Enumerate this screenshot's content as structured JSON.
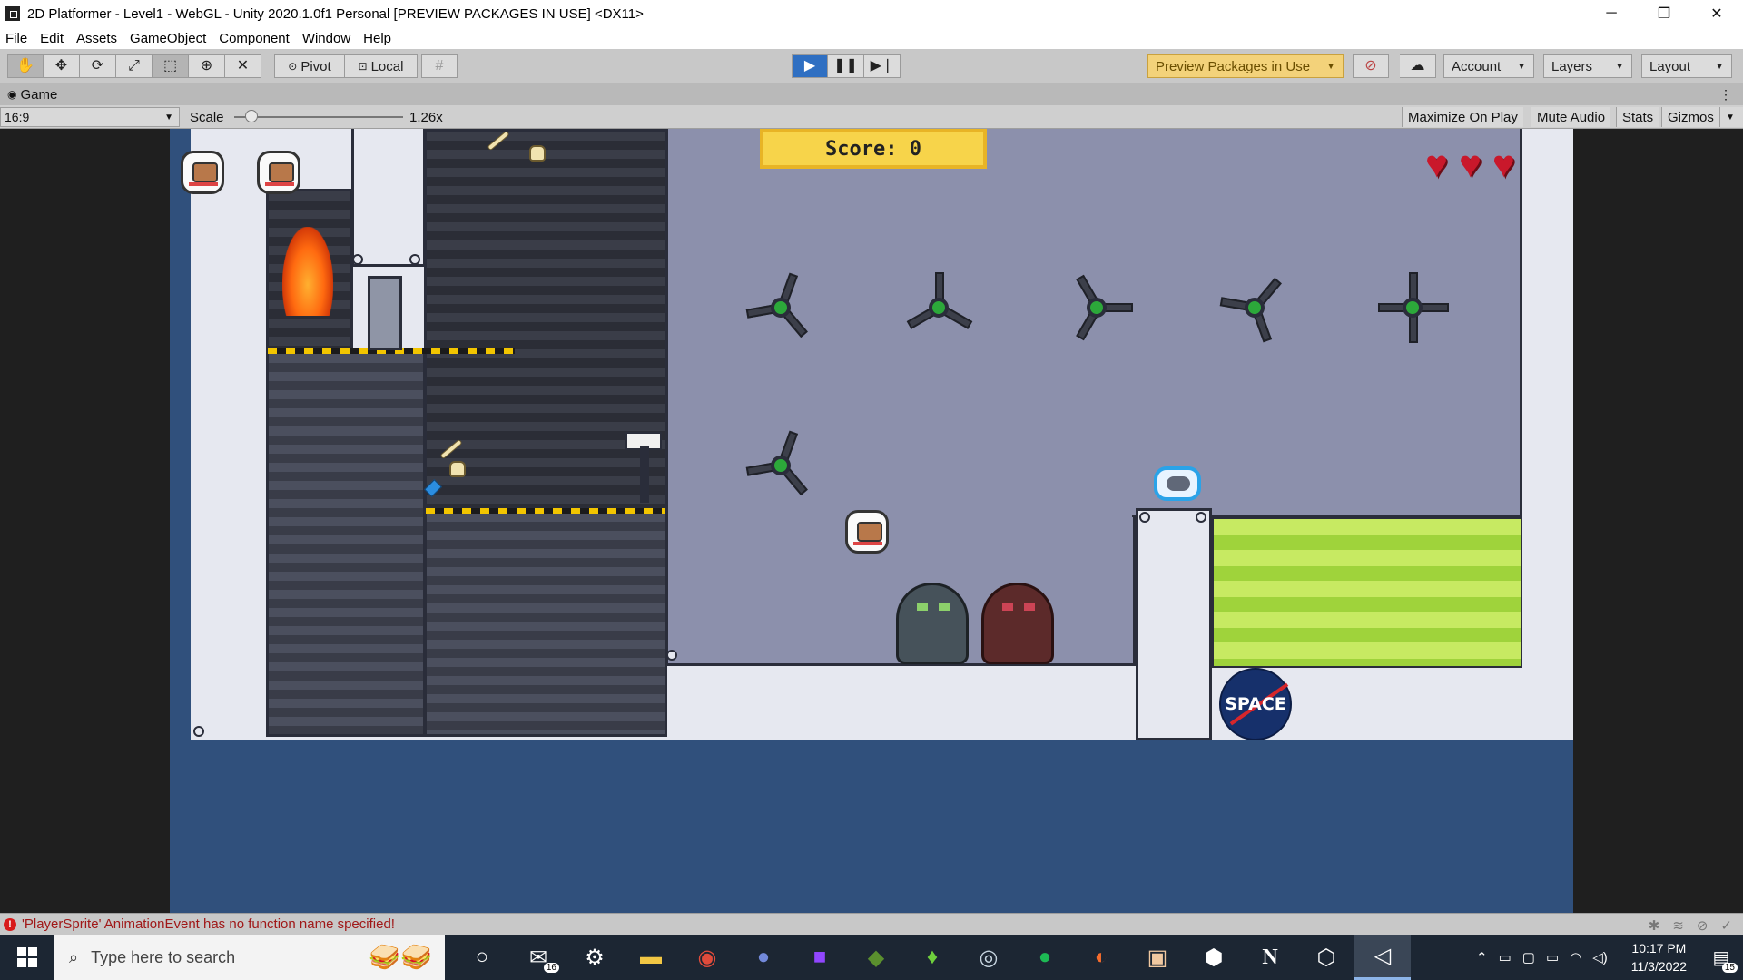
{
  "window": {
    "title": "2D Platformer - Level1 - WebGL - Unity 2020.1.0f1 Personal [PREVIEW PACKAGES IN USE] <DX11>",
    "controls": {
      "minimize": "─",
      "maximize": "❐",
      "close": "✕"
    }
  },
  "menu": [
    "File",
    "Edit",
    "Assets",
    "GameObject",
    "Component",
    "Window",
    "Help"
  ],
  "toolbar": {
    "tools": [
      "hand-tool-icon",
      "move-tool-icon",
      "rotate-tool-icon",
      "scale-tool-icon",
      "rect-tool-icon",
      "transform-tool-icon",
      "custom-tool-icon"
    ],
    "pivot_label": "Pivot",
    "local_label": "Local",
    "preview_packages_label": "Preview Packages in Use",
    "account_label": "Account",
    "layers_label": "Layers",
    "layout_label": "Layout"
  },
  "tab": {
    "label": "Game"
  },
  "game_controls": {
    "aspect": "16:9",
    "scale_label": "Scale",
    "scale_value": "1.26x",
    "scale_fraction": 0.1,
    "maximize_on_play": "Maximize On Play",
    "mute_audio": "Mute Audio",
    "stats": "Stats",
    "gizmos": "Gizmos"
  },
  "game": {
    "score_text": "Score: 0",
    "hearts": 3,
    "logo_text": "SPACE"
  },
  "console": {
    "message": "'PlayerSprite' AnimationEvent has no function name specified!"
  },
  "taskbar": {
    "search_placeholder": "Type here to search",
    "mail_badge": "16",
    "time": "10:17 PM",
    "date": "11/3/2022",
    "notification_count": "15"
  },
  "colors": {
    "play_button": "#2f6fc2",
    "preview_packages": "#f3d27a",
    "game_background": "#30507c",
    "error": "#d81b1b"
  }
}
